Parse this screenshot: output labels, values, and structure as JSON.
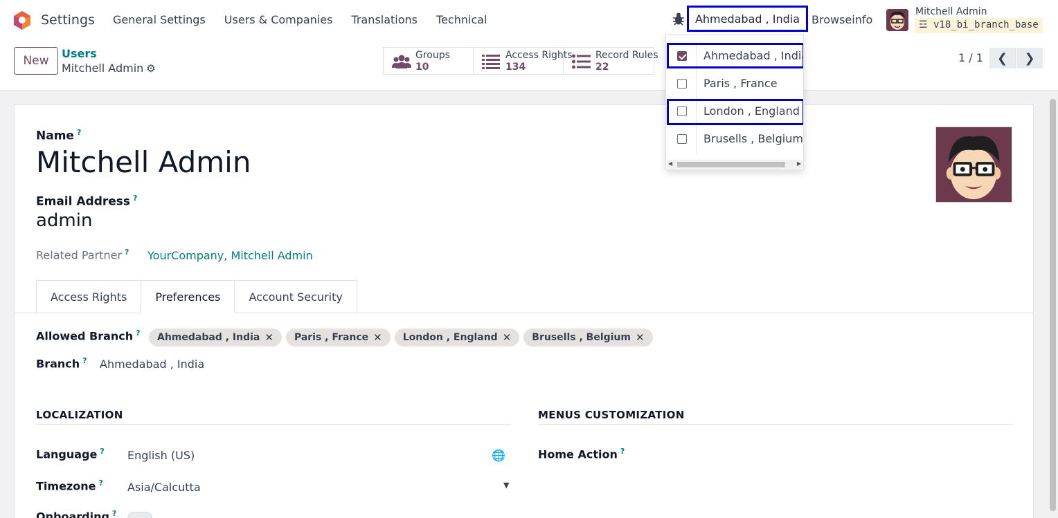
{
  "navbar": {
    "app_title": "Settings",
    "menu": [
      "General Settings",
      "Users & Companies",
      "Translations",
      "Technical"
    ],
    "branch_switcher": "Ahmedabad , India",
    "company": "Browseinfo",
    "user_name": "Mitchell Admin",
    "database": "v18_bi_branch_base"
  },
  "control": {
    "new_label": "New",
    "breadcrumb_parent": "Users",
    "breadcrumb_current": "Mitchell Admin",
    "smart_buttons": [
      {
        "label": "Groups",
        "value": "10"
      },
      {
        "label": "Access Rights",
        "value": "134"
      },
      {
        "label": "Record Rules",
        "value": "22"
      }
    ],
    "pager": "1 / 1"
  },
  "branch_dropdown": {
    "items": [
      {
        "label": "Ahmedabad , India",
        "checked": true
      },
      {
        "label": "Paris , France",
        "checked": false
      },
      {
        "label": "London , England",
        "checked": false
      },
      {
        "label": "Brusells , Belgium",
        "checked": false
      }
    ]
  },
  "form": {
    "name_label": "Name",
    "name_value": "Mitchell Admin",
    "email_label": "Email Address",
    "email_value": "admin",
    "partner_label": "Related Partner",
    "partner_value": "YourCompany, Mitchell Admin",
    "tip": "?",
    "tabs": [
      "Access Rights",
      "Preferences",
      "Account Security"
    ],
    "active_tab": "Preferences",
    "allowed_branch_label": "Allowed Branch",
    "allowed_branches": [
      "Ahmedabad , India",
      "Paris , France",
      "London , England",
      "Brusells , Belgium"
    ],
    "branch_label": "Branch",
    "branch_value": "Ahmedabad , India",
    "localization_title": "LOCALIZATION",
    "menus_title": "MENUS CUSTOMIZATION",
    "language_label": "Language",
    "language_value": "English (US)",
    "timezone_label": "Timezone",
    "timezone_value": "Asia/Calcutta",
    "onboarding_label": "Onboarding",
    "home_action_label": "Home Action"
  },
  "colors": {
    "brand": "#714b67",
    "link": "#017e84",
    "highlight": "#0000cc"
  }
}
